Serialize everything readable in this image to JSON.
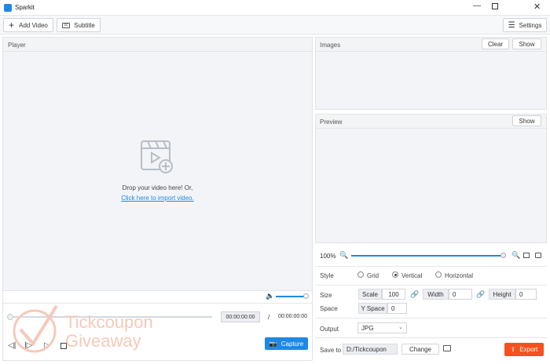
{
  "app": {
    "title": "Sparkit"
  },
  "toolbar": {
    "add_video": "Add Video",
    "subtitle": "Subtitle",
    "settings": "Settings"
  },
  "player": {
    "header": "Player",
    "drop_text": "Drop your video here! Or,",
    "import_link": "Click here to import video.",
    "current_time": "00:00:00:00",
    "separator": "/",
    "total_time": "00:00:00:00",
    "capture_label": "Capture"
  },
  "images": {
    "header": "Images",
    "clear": "Clear",
    "show": "Show"
  },
  "preview": {
    "header": "Preview",
    "show": "Show",
    "zoom": "100%"
  },
  "settings": {
    "style_label": "Style",
    "style_options": [
      "Grid",
      "Vertical",
      "Horizontal"
    ],
    "style_selected": "Vertical",
    "size_label": "Size",
    "scale_label": "Scale",
    "scale_value": "100",
    "width_label": "Width",
    "width_value": "0",
    "height_label": "Height",
    "height_value": "0",
    "space_label": "Space",
    "yspace_label": "Y Space",
    "yspace_value": "0",
    "output_label": "Output",
    "output_value": "JPG",
    "saveto_label": "Save to",
    "saveto_value": "D:/Tickcoupon",
    "change_label": "Change",
    "export_label": "Export"
  },
  "watermark": {
    "line1": "Tickcoupon",
    "line2": "Giveaway"
  },
  "colors": {
    "accent": "#1e88e5",
    "export": "#f4511e",
    "watermark": "#f6c9b9"
  }
}
